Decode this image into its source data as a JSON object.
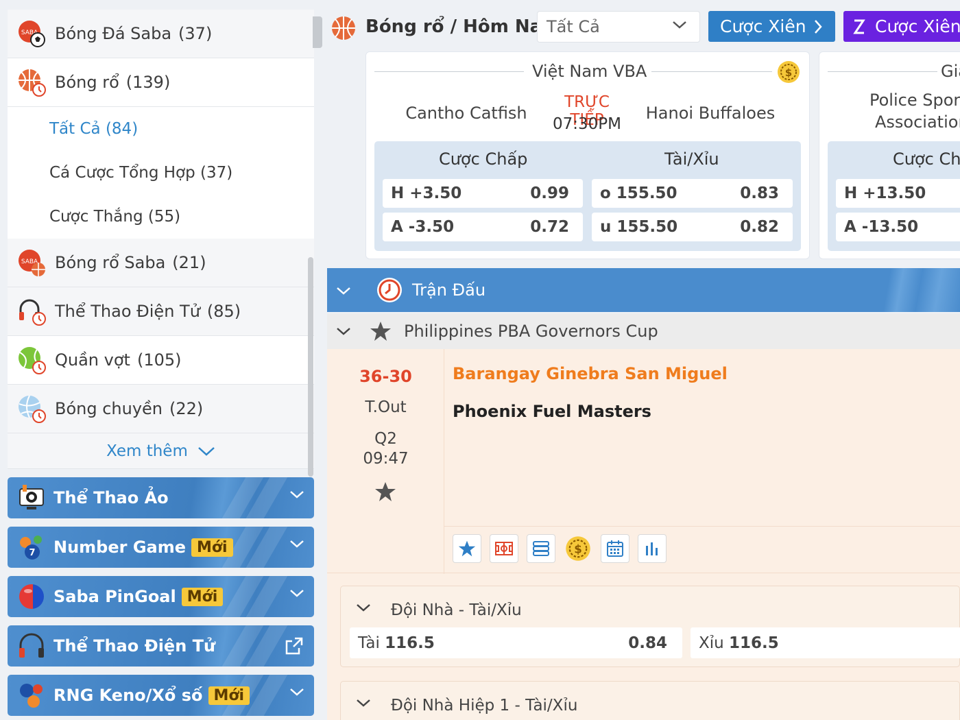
{
  "sidebar": {
    "top_items": [
      {
        "label": "Bóng Đá Saba",
        "count": "(37)"
      },
      {
        "label": "Bóng rổ",
        "count": "(139)"
      }
    ],
    "sub_items": [
      {
        "label": "Tất Cả",
        "count": "(84)"
      },
      {
        "label": "Cá Cược Tổng Hợp",
        "count": "(37)"
      },
      {
        "label": "Cược Thắng",
        "count": "(55)"
      }
    ],
    "items": [
      {
        "label": "Bóng rổ Saba",
        "count": "(21)"
      },
      {
        "label": "Thể Thao Điện Tử",
        "count": "(85)"
      },
      {
        "label": "Quần vợt",
        "count": "(105)"
      },
      {
        "label": "Bóng chuyền",
        "count": "(22)"
      }
    ],
    "more_label": "Xem thêm",
    "sections": [
      {
        "label": "Thể Thao Ảo",
        "badge": ""
      },
      {
        "label": "Number Game",
        "badge": "Mới"
      },
      {
        "label": "Saba PinGoal",
        "badge": "Mới"
      },
      {
        "label": "Thể Thao Điện Tử",
        "badge": ""
      },
      {
        "label": "RNG Keno/Xổ số",
        "badge": "Mới"
      }
    ],
    "saba_badge": "SABA"
  },
  "header": {
    "title": "Bóng rổ / Hôm Nay",
    "filter_value": "Tất Cả",
    "parlay_label": "Cược Xiên",
    "parlay_label_2": "Cược Xiên"
  },
  "cards": [
    {
      "league": "Việt Nam VBA",
      "home": "Cantho Catfish",
      "away": "Hanoi Buffaloes",
      "live": "TRỰC TIẾP",
      "time": "07:30PM",
      "handicap_header": "Cược Chấp",
      "ou_header": "Tài/Xỉu",
      "h_line": "H +3.50",
      "h_odds": "0.99",
      "a_line": "A -3.50",
      "a_odds": "0.72",
      "o_line": "o 155.50",
      "o_odds": "0.83",
      "u_line": "u 155.50",
      "u_odds": "0.82"
    },
    {
      "league": "Gia",
      "home_line1": "Police Sport",
      "home_line2": "Association",
      "handicap_header": "Cược Ch",
      "h_line": "H +13.50",
      "a_line": "A -13.50"
    }
  ],
  "tran_dau": "Trận Đấu",
  "league_row": "Philippines PBA Governors Cup",
  "match": {
    "score": "36-30",
    "status": "T.Out",
    "period": "Q2",
    "clock": "09:47",
    "home": "Barangay Ginebra San Miguel",
    "away": "Phoenix Fuel Masters"
  },
  "markets": [
    {
      "title": "Đội Nhà - Tài/Xỉu",
      "over_label": "Tài",
      "over_line": "116.5",
      "over_odds": "0.84",
      "under_label": "Xỉu",
      "under_line": "116.5"
    },
    {
      "title": "Đội Nhà Hiệp 1 - Tài/Xỉu"
    }
  ],
  "colors": {
    "accent_blue": "#2f7fc6",
    "parlay_purple": "#6a22e0",
    "live_red": "#e0452a",
    "home_orange": "#ef7c1d",
    "badge_yellow": "#f6c83a"
  }
}
